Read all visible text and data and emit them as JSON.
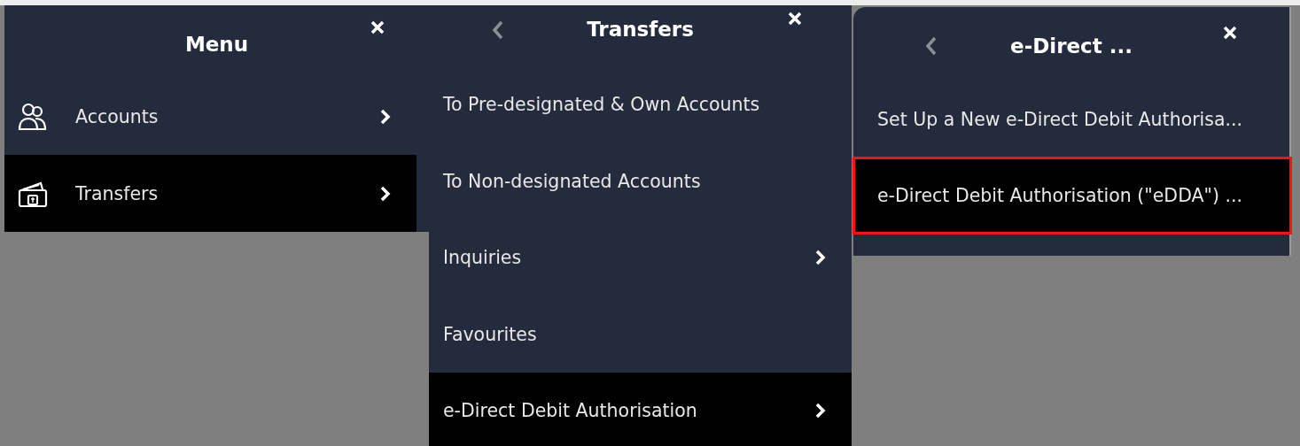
{
  "panels": [
    {
      "title": "Menu",
      "back": false,
      "items": [
        {
          "label": "Accounts",
          "submenu": true,
          "selected": false,
          "highlighted": false
        },
        {
          "label": "Transfers",
          "submenu": true,
          "selected": true,
          "highlighted": false
        }
      ]
    },
    {
      "title": "Transfers",
      "back": true,
      "items": [
        {
          "label": "To Pre-designated & Own Accounts",
          "submenu": false,
          "selected": false,
          "highlighted": false
        },
        {
          "label": "To Non-designated Accounts",
          "submenu": false,
          "selected": false,
          "highlighted": false
        },
        {
          "label": "Inquiries",
          "submenu": true,
          "selected": false,
          "highlighted": false
        },
        {
          "label": "Favourites",
          "submenu": false,
          "selected": false,
          "highlighted": false
        },
        {
          "label": "e-Direct Debit Authorisation",
          "submenu": true,
          "selected": true,
          "highlighted": false
        }
      ]
    },
    {
      "title": "e-Direct ...",
      "back": true,
      "items": [
        {
          "label": "Set Up a New e-Direct Debit Authorisa...",
          "submenu": false,
          "selected": false,
          "highlighted": false
        },
        {
          "label": "e-Direct Debit Authorisation (\"eDDA\") ...",
          "submenu": false,
          "selected": true,
          "highlighted": true
        }
      ]
    }
  ]
}
